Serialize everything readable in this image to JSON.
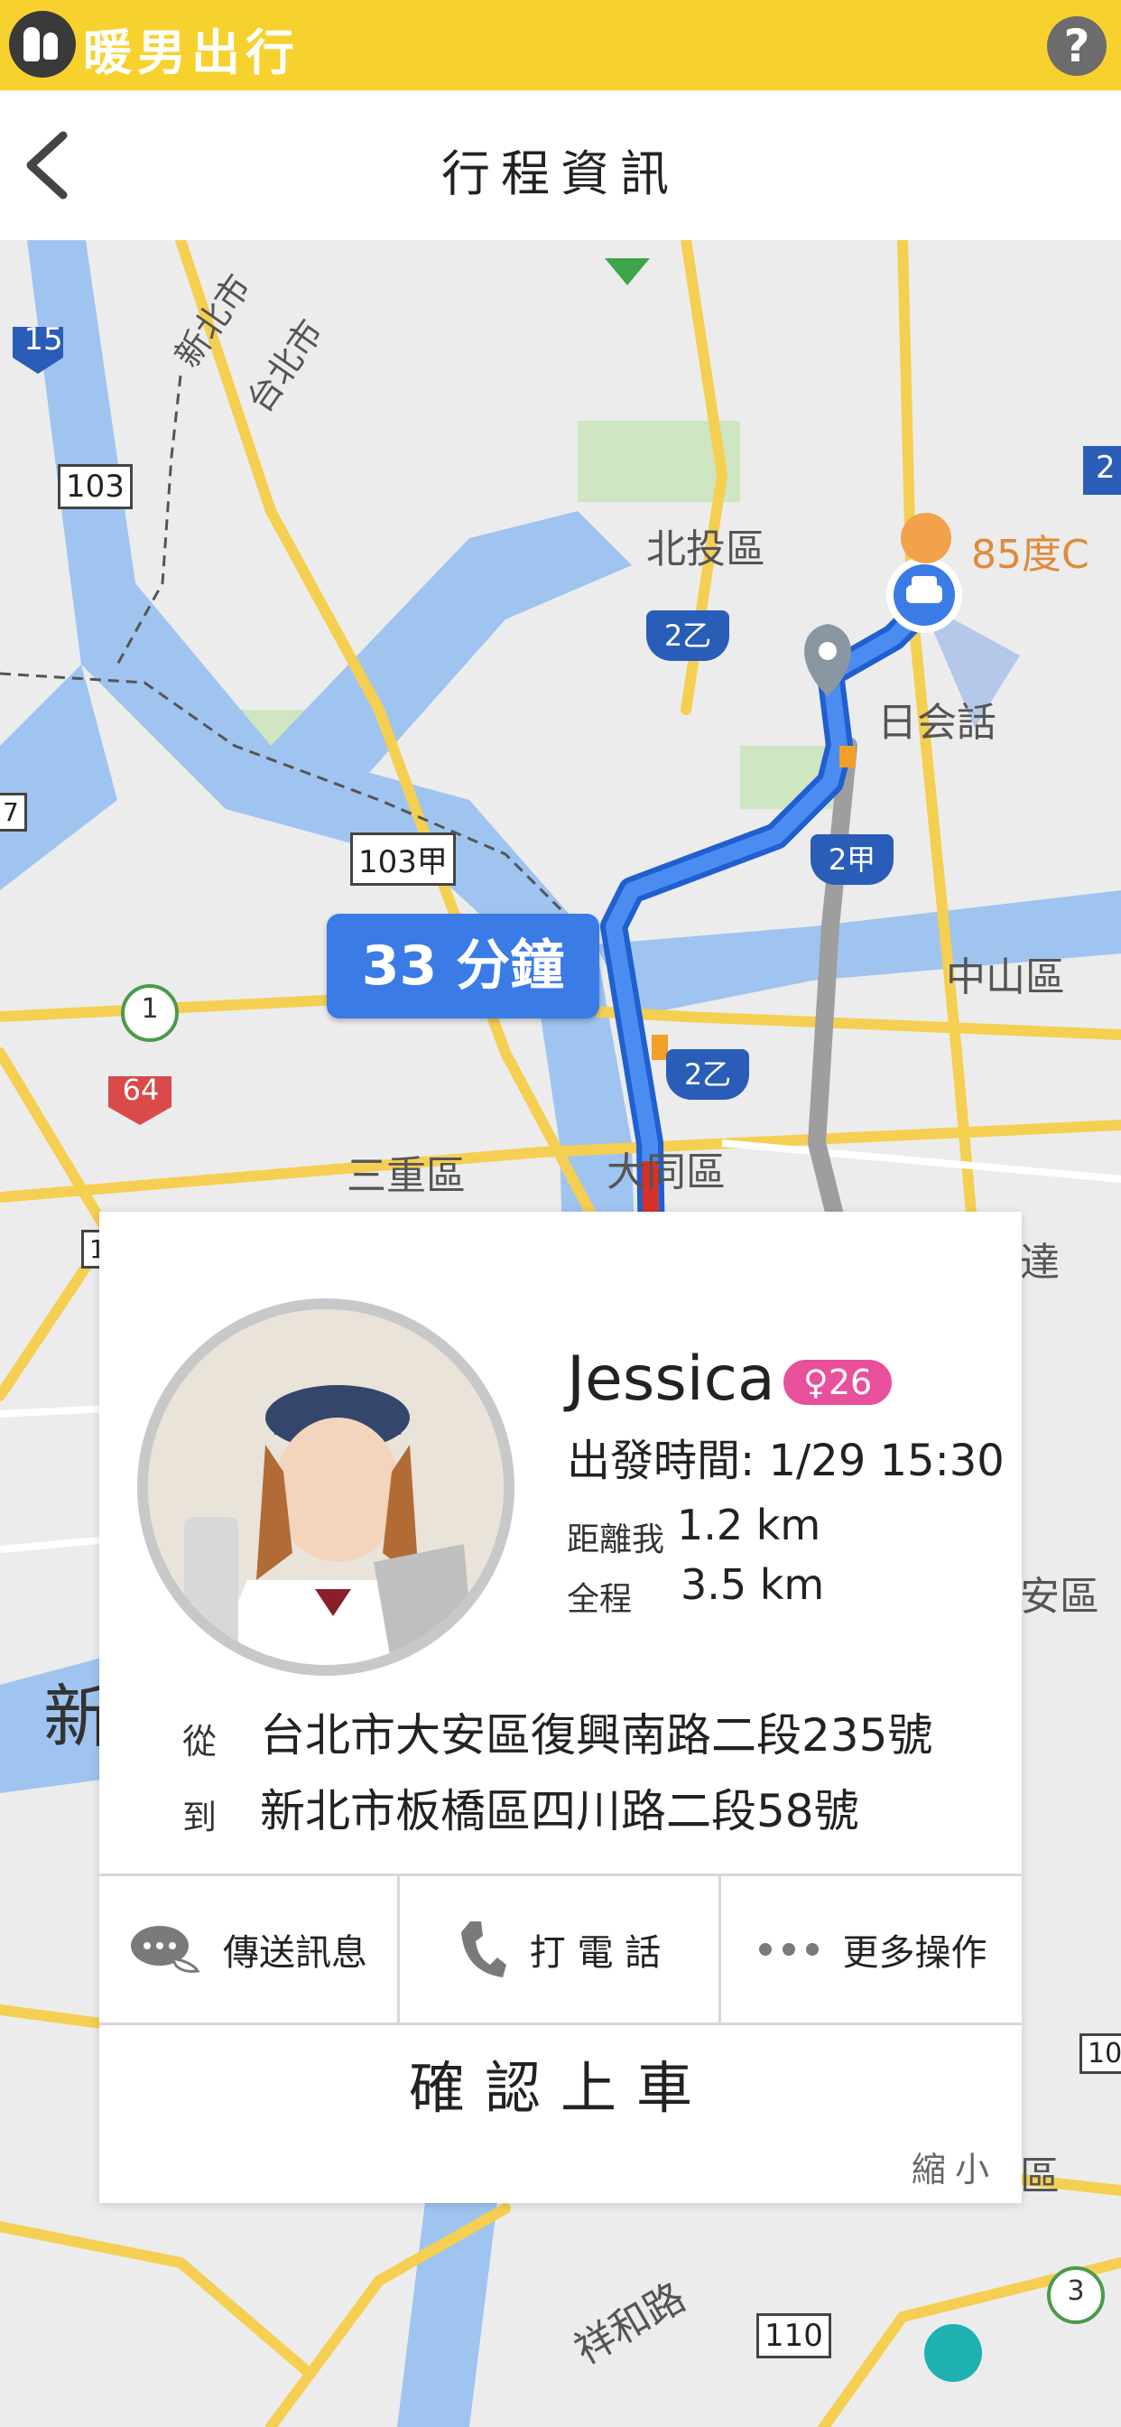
{
  "brand": {
    "title": "暖男出行",
    "help_label": "?"
  },
  "header": {
    "title": "行程資訊"
  },
  "map": {
    "eta": "33 分鐘",
    "labels": {
      "beitou": "北投區",
      "zhongshan": "中山區",
      "sanchong": "三重區",
      "datong": "大同區",
      "new_taipei": "新北市",
      "taipei": "台北市",
      "rihuihua": "日会話",
      "cafe": "85度C",
      "xianghe": "祥和路",
      "partial_xin": "新",
      "partial_da": "達",
      "partial_an": "安區",
      "partial_qu": "區"
    },
    "routes": {
      "r15": "15",
      "r103": "103",
      "r103a": "103甲",
      "r2y": "2乙",
      "r2y_b": "2乙",
      "r2j": "2甲",
      "r64": "64",
      "r1": "1",
      "r3": "3",
      "r110": "110",
      "r2": "2",
      "r10": "10",
      "r7": "7",
      "r1b": "1"
    },
    "colors": {
      "water": "#9fc4ef",
      "route": "#3a7be6",
      "alt_route": "#9e9e9e",
      "road": "#f5cf52"
    }
  },
  "trip": {
    "name": "Jessica",
    "gender_age": "♀26",
    "depart_label": "出發時間:",
    "depart_time": "1/29 15:30",
    "distance_label": "距離我",
    "distance_value": "1.2 km",
    "total_label": "全程",
    "total_value": "3.5 km",
    "from_label": "從",
    "from_address": "台北市大安區復興南路二段235號",
    "to_label": "到",
    "to_address": "新北市板橋區四川路二段58號"
  },
  "actions": {
    "message": "傳送訊息",
    "call": "打 電 話",
    "more": "更多操作"
  },
  "confirm_label": "確認上車",
  "shrink_label": "縮小"
}
